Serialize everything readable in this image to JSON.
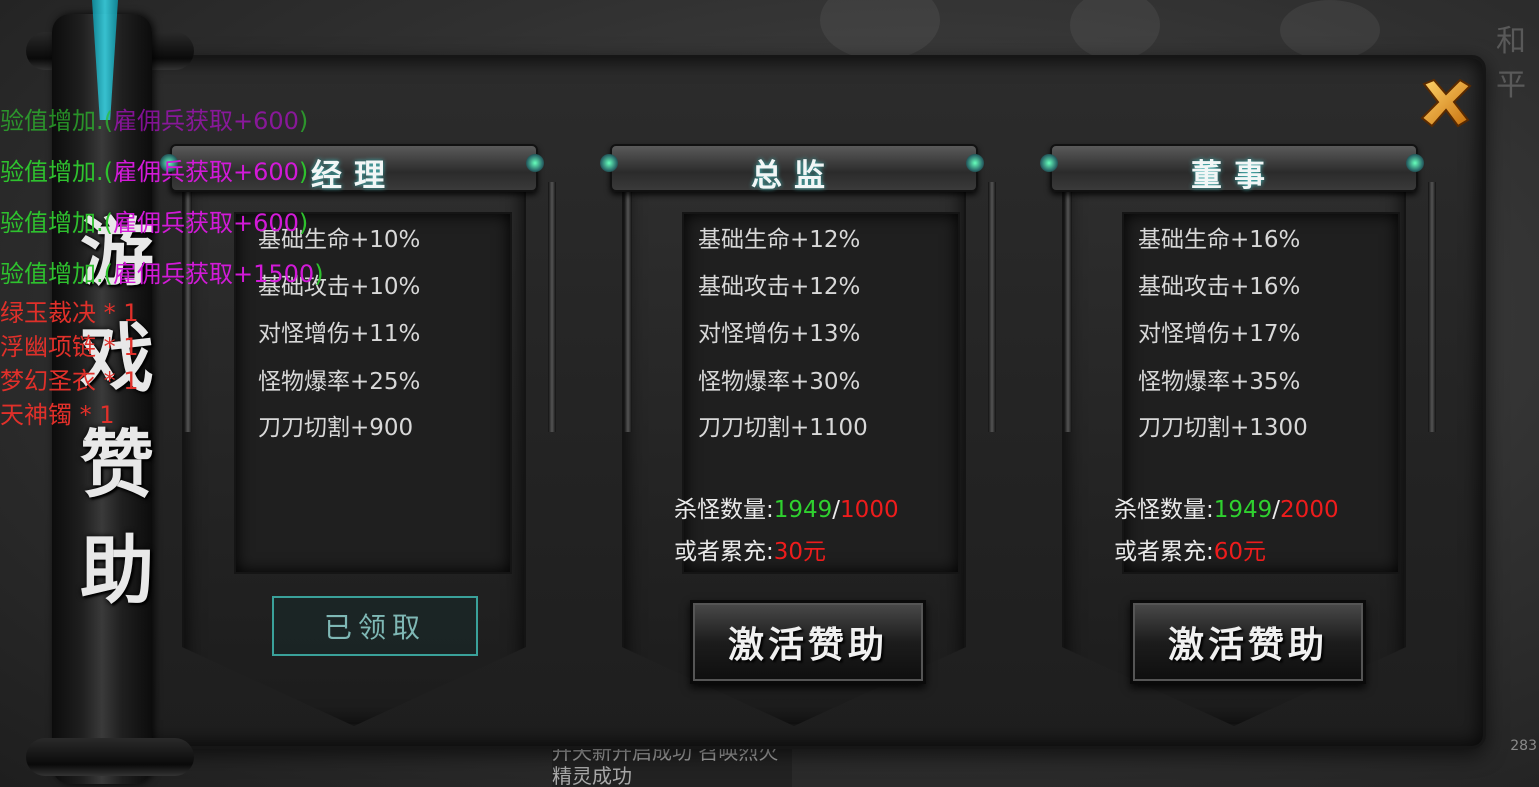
{
  "title_vertical": "游戏赞助",
  "background": {
    "top_right_text": "和平",
    "edge_number": "283",
    "bottom_strip": "升天新开启成功 召唤烈火精灵成功"
  },
  "chat_feed": [
    {
      "prefix": "验值增加.(",
      "highlight": "雇佣兵获取+600",
      "suffix": ")",
      "prefix_color": "#2ec22e",
      "highlight_color": "#b010c8"
    },
    {
      "prefix": "验值增加.(",
      "highlight": "雇佣兵获取+600",
      "suffix": ")",
      "prefix_color": "#2ec22e",
      "highlight_color": "#d21ad8"
    },
    {
      "prefix": "验值增加.(",
      "highlight": "雇佣兵获取+600",
      "suffix": ")",
      "prefix_color": "#2ec22e",
      "highlight_color": "#d21ad8"
    },
    {
      "prefix": "验值增加.(",
      "highlight": "雇佣兵获取+1500",
      "suffix": ")",
      "prefix_color": "#2ec22e",
      "highlight_color": "#d21ad8"
    }
  ],
  "loot_feed": [
    "绿玉裁决 * 1",
    "浮幽项链 * 1",
    "梦幻圣衣 * 1",
    "天神镯 * 1"
  ],
  "cards": [
    {
      "title": "经理",
      "stats": [
        "基础生命+10%",
        "基础攻击+10%",
        "对怪增伤+11%",
        "怪物爆率+25%",
        "刀刀切割+900"
      ],
      "status": "已领取"
    },
    {
      "title": "总监",
      "stats": [
        "基础生命+12%",
        "基础攻击+12%",
        "对怪增伤+13%",
        "怪物爆率+30%",
        "刀刀切割+1100"
      ],
      "kill_label": "杀怪数量:",
      "kill_current": "1949",
      "kill_sep": "/",
      "kill_required": "1000",
      "recharge_label": "或者累充:",
      "recharge_amount": "30元",
      "button": "激活赞助"
    },
    {
      "title": "董事",
      "stats": [
        "基础生命+16%",
        "基础攻击+16%",
        "对怪增伤+17%",
        "怪物爆率+35%",
        "刀刀切割+1300"
      ],
      "kill_label": "杀怪数量:",
      "kill_current": "1949",
      "kill_sep": "/",
      "kill_required": "2000",
      "recharge_label": "或者累充:",
      "recharge_amount": "60元",
      "button": "激活赞助"
    }
  ],
  "colors": {
    "accent_teal": "#3aa19a",
    "value_green": "#2fd12f",
    "value_red": "#ee1c1c",
    "close_gold": "#f0a020"
  }
}
